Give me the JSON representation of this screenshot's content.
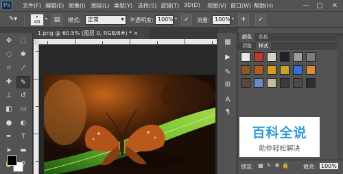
{
  "app": {
    "logo": "Ps"
  },
  "menu": [
    "文件(F)",
    "编辑(E)",
    "图像(I)",
    "图层(L)",
    "类型(Y)",
    "选择(S)",
    "滤镜(T)",
    "3D(D)",
    "视图(V)",
    "窗口(W)",
    "帮助(H)"
  ],
  "window_controls": {
    "minimize": "—",
    "maximize": "□",
    "close": "✕"
  },
  "options": {
    "brush_size": "40",
    "mode_label": "模式:",
    "mode_value": "正常",
    "opacity_label": "不透明度:",
    "opacity_value": "100%",
    "flow_label": "流量:",
    "flow_value": "100%"
  },
  "document": {
    "tab_title": "1.png @ 60.5% (图层 0, RGB/8#) *",
    "close_symbol": "×"
  },
  "panels": {
    "top_tabs": [
      "颜色",
      "色板"
    ],
    "second_tabs": [
      "调整",
      "样式"
    ],
    "style_swatch_colors": [
      "#e8e8e8",
      "#c0392b",
      "#d6d2c4",
      "#222222",
      "#9c9c9c",
      "#7d7d7d",
      "#8b5a2b",
      "#b35c1e",
      "#d4a017",
      "#c9a227",
      "#3a6bd6",
      "#d98a36",
      "#5a4a3a",
      "#6a8cc7",
      "#c6b9a6",
      "#3c3c3c",
      "#4a4a4a",
      "#2e2e2e"
    ]
  },
  "watermark": {
    "title": "百科全说",
    "subtitle": "助你轻松解决"
  },
  "layers_bar": {
    "lock_label": "锁定:",
    "fill_label": "填充:",
    "fill_value": "100%"
  },
  "colors": {
    "foreground": "#000000",
    "background": "#ffffff"
  }
}
